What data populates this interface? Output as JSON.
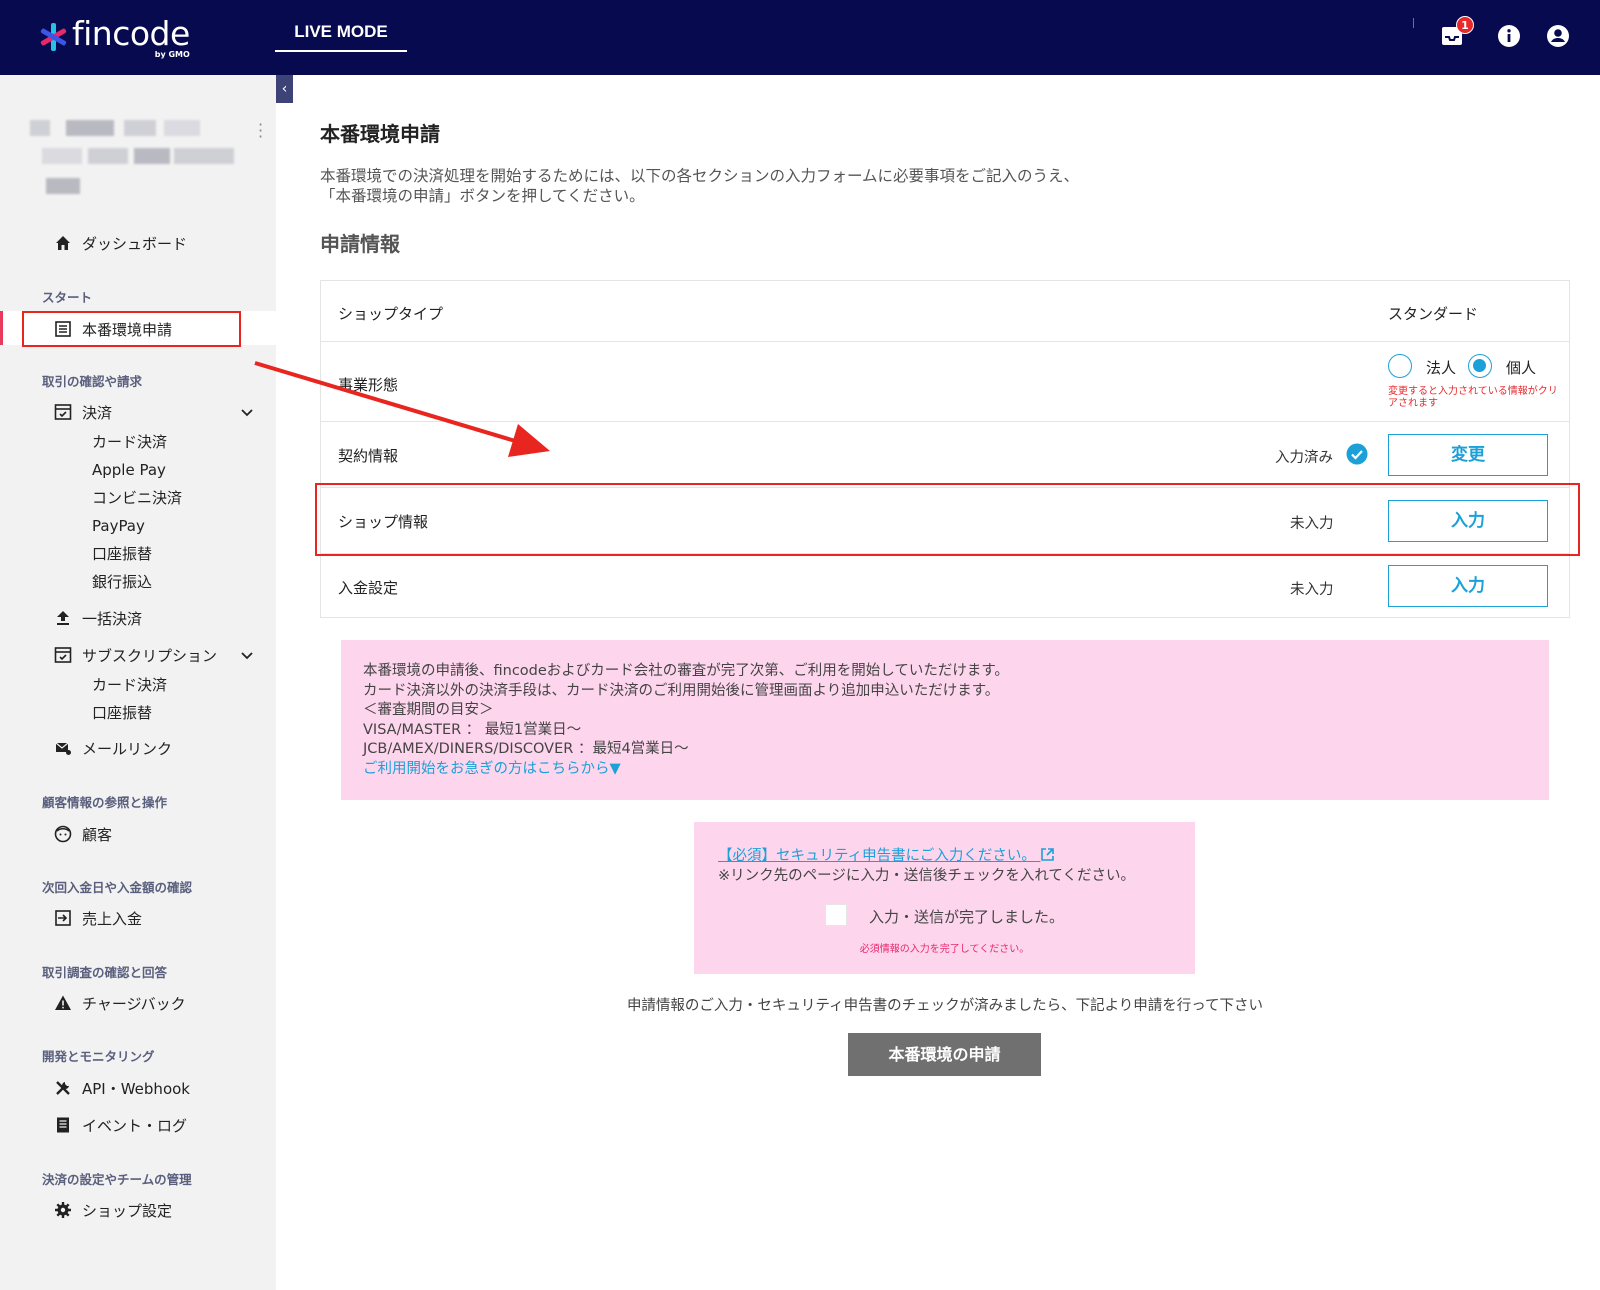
{
  "header": {
    "logo_text": "fincode",
    "logo_sub": "by GMO",
    "mode_label": "LIVE MODE",
    "notification_count": "1",
    "brand_color": "#070a4e"
  },
  "sidebar": {
    "dashboard": "ダッシュボード",
    "section_start": "スタート",
    "production_apply": "本番環境申請",
    "section_transactions": "取引の確認や請求",
    "payment": "決済",
    "payment_subs": [
      "カード決済",
      "Apple Pay",
      "コンビニ決済",
      "PayPay",
      "口座振替",
      "銀行振込"
    ],
    "bulk_payment": "一括決済",
    "subscription": "サブスクリプション",
    "subscription_subs": [
      "カード決済",
      "口座振替"
    ],
    "mail_link": "メールリンク",
    "section_customers": "顧客情報の参照と操作",
    "customers": "顧客",
    "section_deposit": "次回入金日や入金額の確認",
    "sales_deposit": "売上入金",
    "section_investigation": "取引調査の確認と回答",
    "chargeback": "チャージバック",
    "section_dev": "開発とモニタリング",
    "api_webhook": "API・Webhook",
    "event_log": "イベント・ログ",
    "section_settings": "決済の設定やチームの管理",
    "shop_settings": "ショップ設定"
  },
  "main": {
    "title": "本番環境申請",
    "description_line1": "本番環境での決済処理を開始するためには、以下の各セクションの入力フォームに必要事項をご記入のうえ、",
    "description_line2": "「本番環境の申請」ボタンを押してください。",
    "section_title": "申請情報",
    "rows": {
      "shop_type_label": "ショップタイプ",
      "shop_type_value": "スタンダード",
      "business_label": "事業形態",
      "business_corporate": "法人",
      "business_individual": "個人",
      "business_warning": "変更すると入力されている情報がクリアされます",
      "contract_label": "契約情報",
      "contract_status": "入力済み",
      "contract_button": "変更",
      "shop_info_label": "ショップ情報",
      "shop_info_status": "未入力",
      "shop_info_button": "入力",
      "deposit_label": "入金設定",
      "deposit_status": "未入力",
      "deposit_button": "入力"
    },
    "info": {
      "line1": "本番環境の申請後、fincodeおよびカード会社の審査が完了次第、ご利用を開始していただけます。",
      "line2": "カード決済以外の決済手段は、カード決済のご利用開始後に管理画面より追加申込いただけます。",
      "line3": "＜審査期間の目安＞",
      "line4": "VISA/MASTER ： 最短1営業日〜",
      "line5": "JCB/AMEX/DINERS/DISCOVER ：最短4営業日〜",
      "link": "ご利用開始をお急ぎの方はこちらから▼"
    },
    "security": {
      "link": "【必須】セキュリティ申告書にご入力ください。",
      "note": "※リンク先のページに入力・送信後チェックを入れてください。",
      "check_label": "入力・送信が完了しました。",
      "error": "必須情報の入力を完了してください。"
    },
    "submit_note": "申請情報のご入力・セキュリティ申告書のチェックが済みましたら、下記より申請を行って下さい",
    "submit_button": "本番環境の申請"
  },
  "colors": {
    "accent": "#1ba0d8",
    "annotation": "#e8251f",
    "info_bg": "#fdd6ee"
  }
}
